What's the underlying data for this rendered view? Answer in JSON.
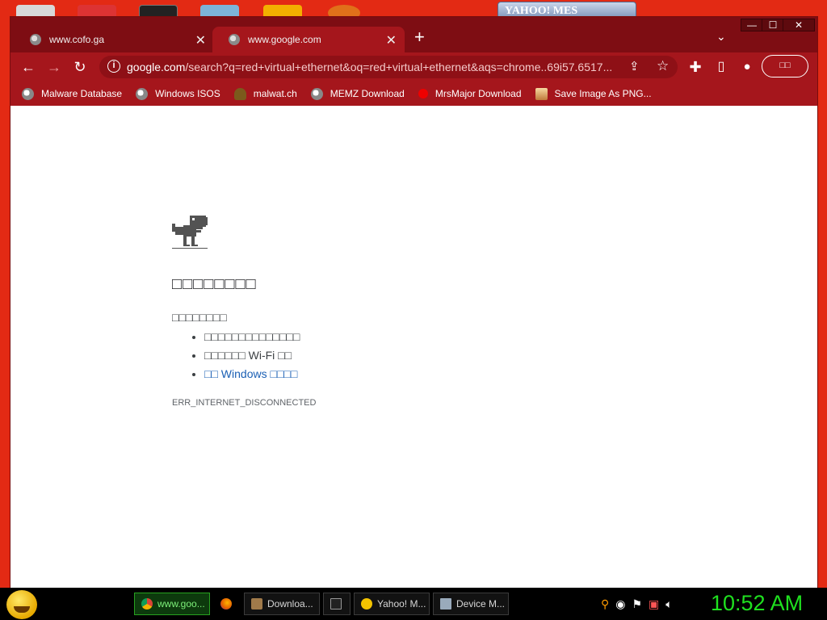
{
  "desktop": {
    "yahoo_peek": "YAHOO! MES"
  },
  "window_controls": {
    "minimize": "—",
    "maximize": "☐",
    "close": "✕"
  },
  "tabs": [
    {
      "title": "www.cofo.ga",
      "active": false
    },
    {
      "title": "www.google.com",
      "active": true
    }
  ],
  "new_tab_label": "+",
  "tab_search_label": "⌄",
  "toolbar": {
    "url_host": "google.com",
    "url_path": "/search?q=red+virtual+ethernet&oq=red+virtual+ethernet&aqs=chrome..69i57.6517...",
    "profile_pill": "□□"
  },
  "bookmarks": [
    {
      "label": "Malware Database",
      "icon": "globe-icon"
    },
    {
      "label": "Windows ISOS",
      "icon": "globe-icon"
    },
    {
      "label": "malwat.ch",
      "icon": "poo-icon"
    },
    {
      "label": "MEMZ Download",
      "icon": "globe-icon"
    },
    {
      "label": "MrsMajor Download",
      "icon": "red-dot-icon"
    },
    {
      "label": "Save Image As PNG...",
      "icon": "image-icon"
    }
  ],
  "error_page": {
    "title": "□□□□□□□□",
    "subtitle": "□□□□□□□□",
    "suggestions": [
      "□□□□□□□□□□□□□□",
      "□□□□□□ Wi-Fi □□"
    ],
    "link_suggestion": "□□ Windows □□□□",
    "error_code": "ERR_INTERNET_DISCONNECTED"
  },
  "taskbar": {
    "tasks": [
      {
        "label": "www.goo...",
        "active": true
      },
      {
        "label": "",
        "active": false
      },
      {
        "label": "Downloa...",
        "active": false
      },
      {
        "label": "",
        "active": false
      },
      {
        "label": "Yahoo! M...",
        "active": false
      },
      {
        "label": "Device M...",
        "active": false
      }
    ],
    "clock": "10:52 AM"
  },
  "colors": {
    "chrome_dark": "#7e0d13",
    "chrome_toolbar": "#a5161c",
    "desktop": "#e32a14",
    "clock": "#1fe01f"
  }
}
